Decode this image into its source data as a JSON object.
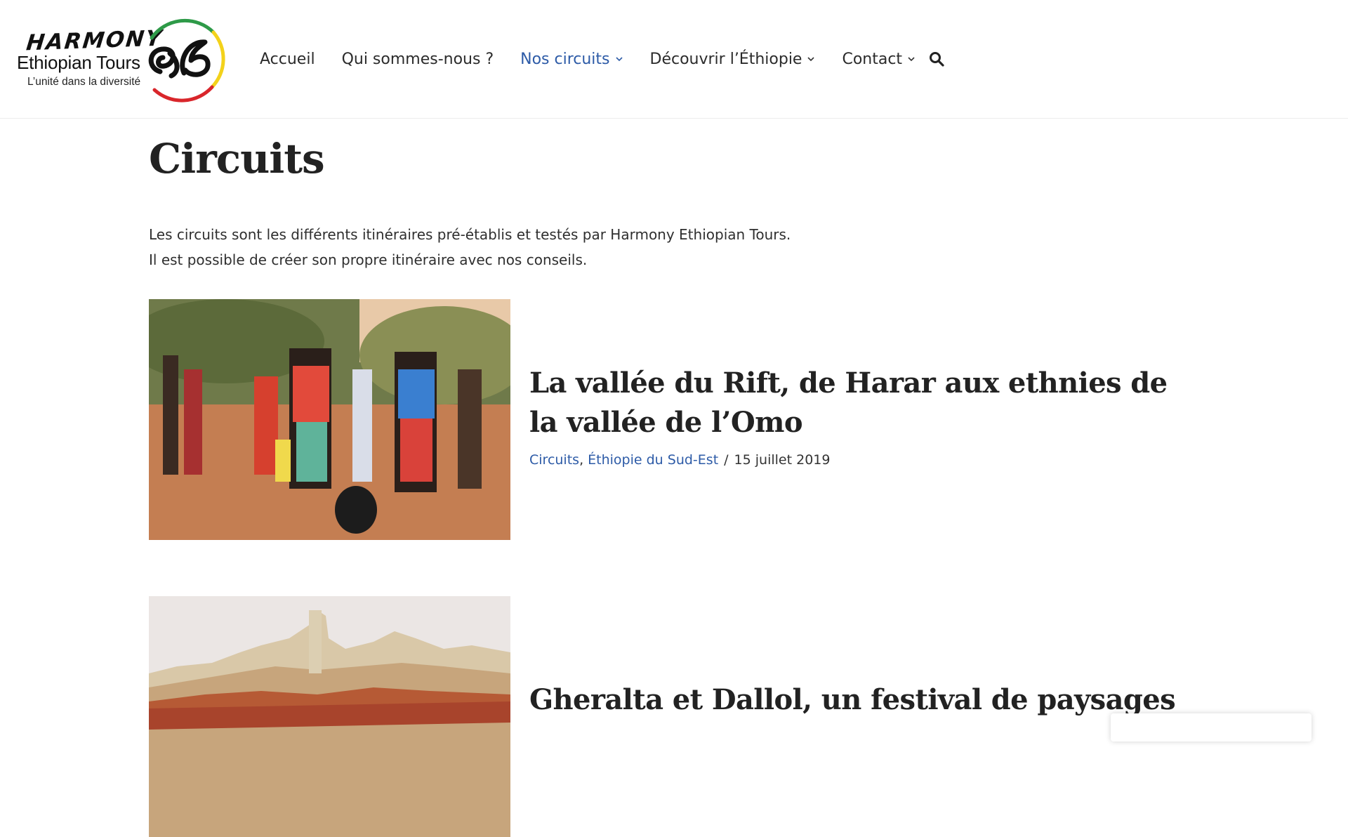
{
  "logo": {
    "brand": "HARMONY",
    "name": "Ethiopian Tours",
    "tagline": "L’unité dans la diversité",
    "colors": [
      "#2e9a48",
      "#f3d21b",
      "#d9262b"
    ]
  },
  "nav": {
    "items": [
      {
        "label": "Accueil",
        "dropdown": false,
        "active": false
      },
      {
        "label": "Qui sommes-nous ?",
        "dropdown": false,
        "active": false
      },
      {
        "label": "Nos circuits",
        "dropdown": true,
        "active": true
      },
      {
        "label": "Découvrir l’Éthiopie",
        "dropdown": true,
        "active": false
      },
      {
        "label": "Contact",
        "dropdown": true,
        "active": false
      }
    ],
    "search_icon": "search-icon",
    "active_color": "#2d5ba7"
  },
  "page": {
    "title": "Circuits",
    "intro": [
      "Les circuits sont les différents itinéraires pré-établis et testés par Harmony Ethiopian Tours.",
      "Il est possible de créer son propre itinéraire avec nos conseils."
    ]
  },
  "posts": [
    {
      "title": "La vallée du Rift, de Harar aux ethnies de la vallée de l’Omo",
      "categories": [
        "Circuits",
        "Éthiopie du Sud-Est"
      ],
      "date": "15 juillet 2019"
    },
    {
      "title": "Gheralta et Dallol, un festival de paysages"
    }
  ]
}
